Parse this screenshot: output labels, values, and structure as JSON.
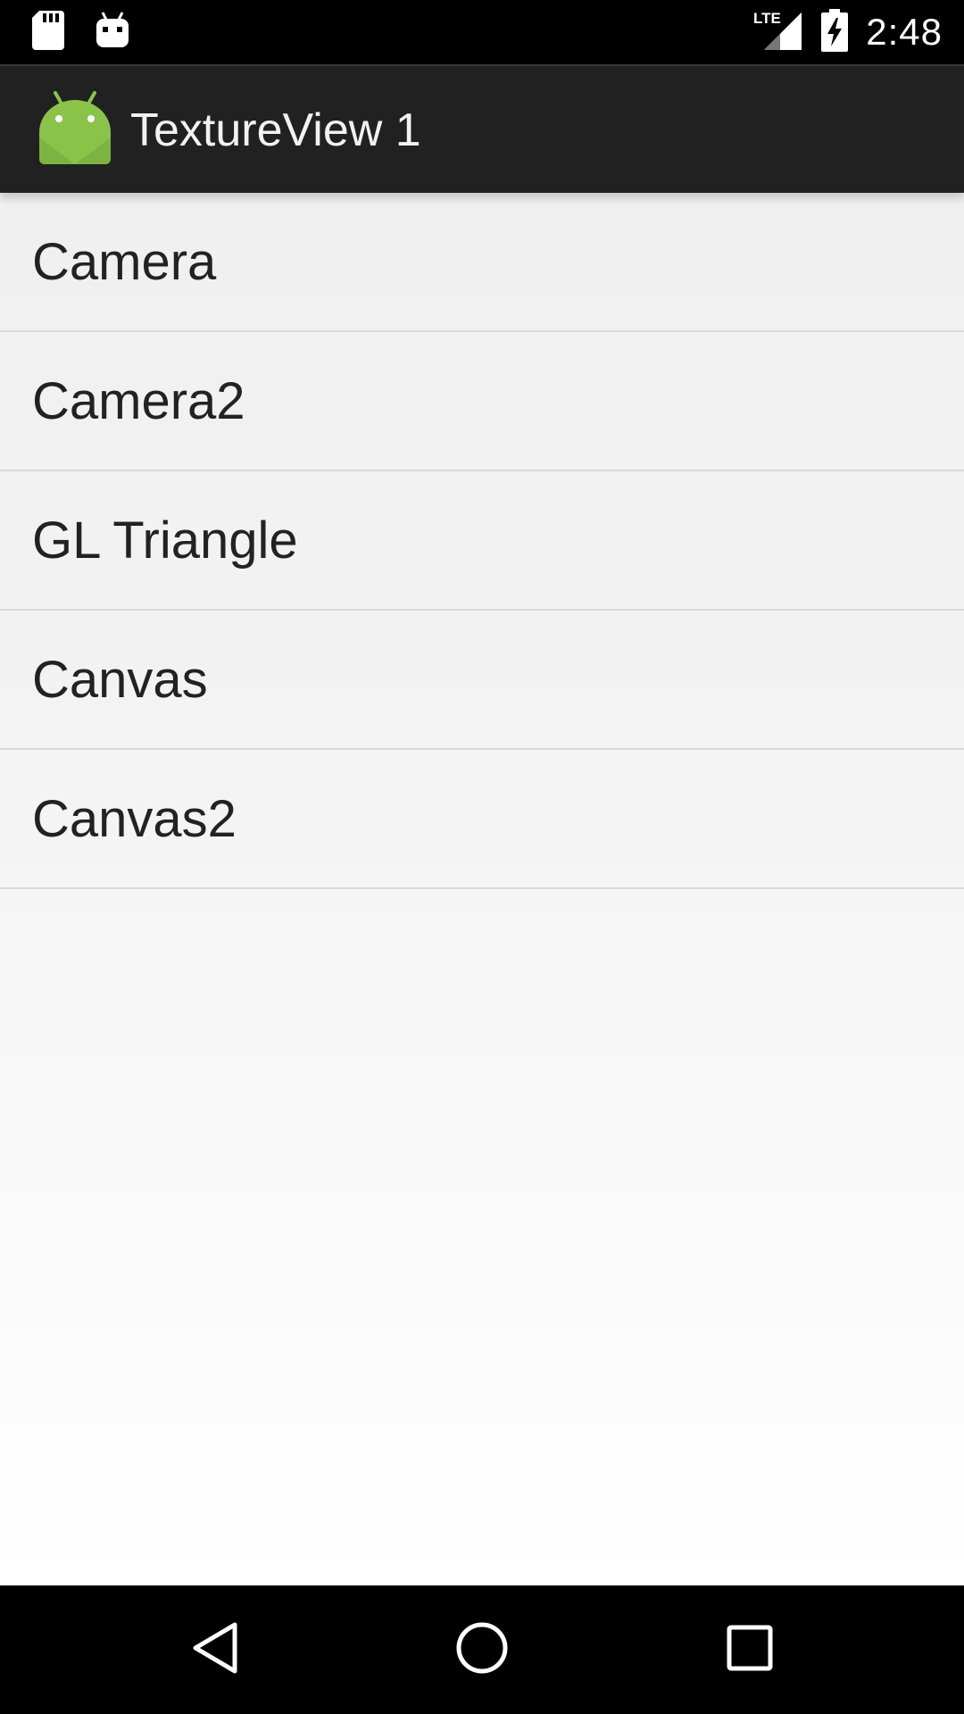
{
  "status_bar": {
    "time": "2:48",
    "network": "LTE",
    "left_icons": [
      "sd-card-icon",
      "android-debug-icon"
    ],
    "right_icons": [
      "lte-signal-icon",
      "battery-charging-icon"
    ]
  },
  "action_bar": {
    "title": "TextureView 1",
    "logo_icon": "android-logo-icon",
    "logo_color": "#8BC34A"
  },
  "list": {
    "items": [
      {
        "label": "Camera"
      },
      {
        "label": "Camera2"
      },
      {
        "label": "GL Triangle"
      },
      {
        "label": "Canvas"
      },
      {
        "label": "Canvas2"
      }
    ]
  },
  "nav_bar": {
    "buttons": [
      "back-icon",
      "home-icon",
      "recents-icon"
    ]
  }
}
